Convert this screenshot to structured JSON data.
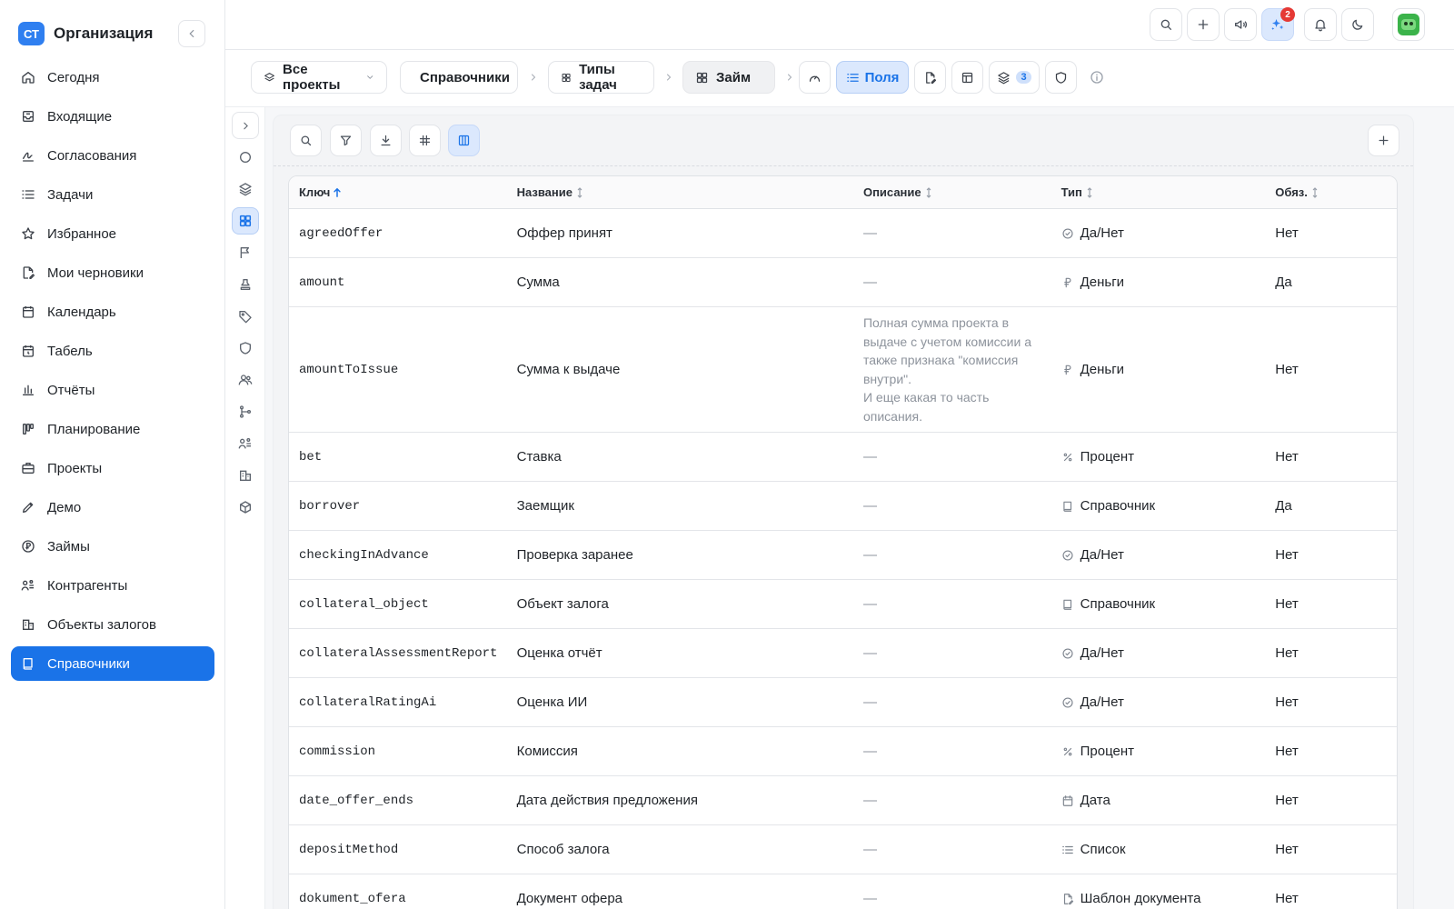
{
  "sidebar": {
    "org_logo": "СТ",
    "org_name": "Организация",
    "items": [
      {
        "label": "Сегодня",
        "icon": "home-icon"
      },
      {
        "label": "Входящие",
        "icon": "inbox-icon"
      },
      {
        "label": "Согласования",
        "icon": "signature-icon"
      },
      {
        "label": "Задачи",
        "icon": "list-icon"
      },
      {
        "label": "Избранное",
        "icon": "star-icon"
      },
      {
        "label": "Мои черновики",
        "icon": "draft-icon"
      },
      {
        "label": "Календарь",
        "icon": "calendar-icon"
      },
      {
        "label": "Табель",
        "icon": "timesheet-icon"
      },
      {
        "label": "Отчёты",
        "icon": "bar-chart-icon"
      },
      {
        "label": "Планирование",
        "icon": "kanban-icon"
      },
      {
        "label": "Проекты",
        "icon": "briefcase-icon"
      },
      {
        "label": "Демо",
        "icon": "pen-icon"
      },
      {
        "label": "Займы",
        "icon": "ruble-icon"
      },
      {
        "label": "Контрагенты",
        "icon": "contacts-icon"
      },
      {
        "label": "Объекты залогов",
        "icon": "building-icon"
      },
      {
        "label": "Справочники",
        "icon": "book-icon",
        "active": true
      }
    ]
  },
  "topbar": {
    "notifications_badge": "2",
    "buttons": [
      "search-icon",
      "plus-icon",
      "megaphone-icon",
      "sparkles-icon",
      "bell-icon",
      "moon-icon",
      "avatar"
    ]
  },
  "breadcrumb": {
    "projects": "Все проекты",
    "dictionaries": "Справочники",
    "task_types": "Типы задач",
    "current": "Займ",
    "fields_tab": "Поля",
    "layers_count": "3"
  },
  "table": {
    "headers": {
      "key": "Ключ",
      "name": "Название",
      "description": "Описание",
      "type": "Тип",
      "required": "Обяз."
    },
    "rows": [
      {
        "key": "agreedOffer",
        "name": "Оффер принят",
        "description": "—",
        "type": "Да/Нет",
        "type_icon": "check-circle-icon",
        "required": "Нет"
      },
      {
        "key": "amount",
        "name": "Сумма",
        "description": "—",
        "type": "Деньги",
        "type_icon": "ruble-icon",
        "required": "Да"
      },
      {
        "key": "amountToIssue",
        "name": "Сумма к выдаче",
        "description_lines": [
          "Полная сумма проекта в",
          "выдаче с учетом комиссии а",
          "также признака \"комиссия",
          "внутри\".",
          "И еще какая то часть",
          "описания."
        ],
        "type": "Деньги",
        "type_icon": "ruble-icon",
        "required": "Нет"
      },
      {
        "key": "bet",
        "name": "Ставка",
        "description": "—",
        "type": "Процент",
        "type_icon": "percent-icon",
        "required": "Нет"
      },
      {
        "key": "borrover",
        "name": "Заемщик",
        "description": "—",
        "type": "Справочник",
        "type_icon": "book-icon",
        "required": "Да"
      },
      {
        "key": "checkingInAdvance",
        "name": "Проверка заранее",
        "description": "—",
        "type": "Да/Нет",
        "type_icon": "check-circle-icon",
        "required": "Нет"
      },
      {
        "key": "collateral_object",
        "name": "Объект залога",
        "description": "—",
        "type": "Справочник",
        "type_icon": "book-icon",
        "required": "Нет"
      },
      {
        "key": "collateralAssessmentReport",
        "name": "Оценка отчёт",
        "description": "—",
        "type": "Да/Нет",
        "type_icon": "check-circle-icon",
        "required": "Нет"
      },
      {
        "key": "collateralRatingAi",
        "name": "Оценка ИИ",
        "description": "—",
        "type": "Да/Нет",
        "type_icon": "check-circle-icon",
        "required": "Нет"
      },
      {
        "key": "commission",
        "name": "Комиссия",
        "description": "—",
        "type": "Процент",
        "type_icon": "percent-icon",
        "required": "Нет"
      },
      {
        "key": "date_offer_ends",
        "name": "Дата действия предложения",
        "description": "—",
        "type": "Дата",
        "type_icon": "calendar-icon",
        "required": "Нет"
      },
      {
        "key": "depositMethod",
        "name": "Способ залога",
        "description": "—",
        "type": "Список",
        "type_icon": "list-icon",
        "required": "Нет"
      },
      {
        "key": "dokument_ofera",
        "name": "Документ офера",
        "description": "—",
        "type": "Шаблон документа",
        "type_icon": "document-template-icon",
        "required": "Нет"
      }
    ]
  }
}
